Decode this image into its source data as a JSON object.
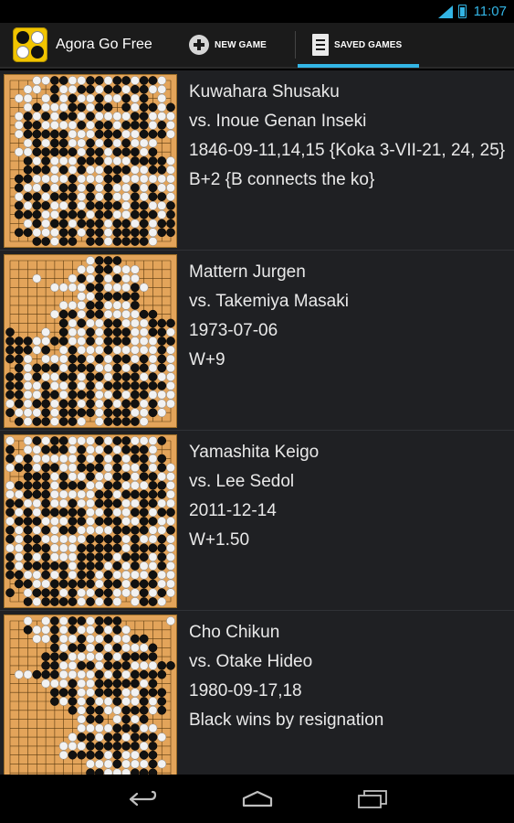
{
  "status_bar": {
    "time": "11:07",
    "accent": "#33b5e5"
  },
  "action_bar": {
    "title": "Agora Go Free",
    "tabs": [
      {
        "label": "NEW GAME",
        "icon": "plus-circle-icon",
        "selected": false
      },
      {
        "label": "SAVED GAMES",
        "icon": "document-icon",
        "selected": true
      }
    ]
  },
  "games": [
    {
      "black": "Kuwahara Shusaku",
      "white": "vs.  Inoue Genan Inseki",
      "date": "1846-09-11,14,15 {Koka 3-VII-21, 24, 25}",
      "result": "B+2  {B connects the ko}",
      "board": [
        "...wwbbwwbbwbbwbbw.",
        "..ww.bwwbbwbbwbbww.",
        ".ww.wbwbwwbwwbwb.w.",
        "..wbwwwbbwbb.bwbbwb",
        ".wbwbwbbwbwwwwbbwww",
        ".wbbwwwwbwbbwbbbwbw",
        ".wbbbbbwwwbbbwwbbbw",
        "..wbwbbwwbwbwbwww..",
        ".wwbbbbbwbbwbbbwb..",
        "..bwbwwwbbbwwwbbbbw",
        "..bbbwbwbwwbbbwwbbw",
        ".bbwwwwbwwwbbwwwwww",
        ".bwwbwbbwbwbwwbwbww",
        ".wbbwbbbwbwbwwbwbbw",
        ".bwbbwwbwbbbbwbbwwb",
        ".bbbwwbbbwbbwwbbbwb",
        "..wbwbbwbbbwbbwbwbb",
        ".bbwwwbbwbbwbbbbwbb",
        "...bbwbb.bbwbbbbw.."
      ]
    },
    {
      "black": "Mattern Jurgen",
      "white": "vs.  Takemiya Masaki",
      "date": "1973-07-06",
      "result": "W+9",
      "board": [
        ".........wbbb......",
        "........wwbbwww....",
        "...w...wbwbwbww....",
        ".....wwwwbbwwwbw...",
        "........wwbbbbb....",
        "......wwwbbwwwb....",
        ".....wbbwbbwwwwbb..",
        "......bwbwwbbwwwbbb",
        "b...w.bwwbwbbbwwbbw",
        "bbbwwbbwwbwbbbwwwbb",
        "bbbwb.wbwwwbwwwwwbw",
        "bbw.wwwbbwbwbbwbwbw",
        ".bwbbbwbbbwwbwbbwbw",
        "bbwbwwbbwbbwbbbwbww",
        "bbwwbwwbwbwbbbbbbbw",
        "bbwwbbwbbbwwbwbbwww",
        "wbwbbwbbwbwbwbbwbww",
        "bwwwbwbbbbwbbbwwbw.",
        ".bwbbwbbw.wbbbbw..."
      ]
    },
    {
      "black": "Yamashita Keigo",
      "white": "vs.  Lee Sedol",
      "date": "2011-12-14",
      "result": "W+1.50",
      "board": [
        "w.wbwbbwwwbwbbwwwb.",
        "b.wwbbbwbwwbwbbbw..",
        "bwbwwwwwbwbwbwbbwb.",
        "wbbwbbwwbbbwbwwbwbw",
        "..bbbwbwwbwwbbwbbww",
        "wbbbbwbbbwwbbwwwbbw",
        "wwbbbwwwwwbbwbbbbbw",
        "bbwwbwwbwwbbbwwbbww",
        "bwbwbbbbbwwbwwbbwbb",
        "wbbbwwwbbwbbbwwbbww",
        "bwbwbwbbwwwwbbbbwwb",
        "bwbbwwwwwbbbbwbwwbw",
        "wwbbbwwwbbbbbwbbbbw",
        "bwbwbwwwbbbbwbbbwbw",
        "bwbbbbbwbbbwbwbwwbw",
        "bbwwbwbwbbwbwwwwbww",
        ".bbwwbbbbbwbbwbbbww",
        "b.wbbbwbwwbbwwwbwbw",
        "..bwbbbbwbwbw.wbbw."
      ]
    },
    {
      "black": "Cho Chikun",
      "white": "vs.  Otake Hideo",
      "date": "1980-09-17,18",
      "result": "Black wins by resignation",
      "board": [
        "..w.wbwbbwbbb.....w",
        "..bwwbwbwwbwbw.....",
        "...wwbwwbwwbwwbb...",
        ".....bwbbwbwbwwwb..",
        "....bbbwwwwbwbbbb..",
        "....bbwwbbwbbbwwwbb",
        ".wwbbbwwwwbwbwbbbb.",
        "....wwwbwwbbbbbwb..",
        ".....bbbwwbbbwwbbb.",
        ".....bwbwbwwbwwbwb.",
        ".......bwbbwwbbbwb.",
        "........wbb.wbwb...",
        "........wwwwbbbww..",
        ".......wbbwbbwbbbw.",
        "......wwwbbbbbbwb..",
        "......wbbbbwbwwbb..",
        ".........wwwbwwwbw.",
        ".........bbwwwbbb..",
        "..........b.w.bb..."
      ]
    }
  ],
  "nav_bar": {
    "buttons": [
      "back-icon",
      "home-icon",
      "recents-icon"
    ]
  }
}
